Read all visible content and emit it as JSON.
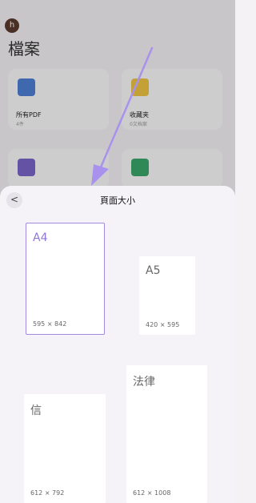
{
  "background": {
    "avatar_letter": "h",
    "title": "檔案",
    "cards": [
      {
        "name": "所有PDF",
        "sub": "4件",
        "icon": "file-icon",
        "color": "#4f7fd6"
      },
      {
        "name": "收藏夹",
        "sub": "0文档案",
        "icon": "star-folder-icon",
        "color": "#f0c542"
      },
      {
        "name": "",
        "sub": "",
        "icon": "folder-icon",
        "color": "#7a65c9"
      },
      {
        "name": "",
        "sub": "",
        "icon": "recycle-icon",
        "color": "#3aa86a"
      }
    ]
  },
  "sheet": {
    "title": "頁面大小",
    "back_glyph": "<",
    "sizes": [
      {
        "name": "A4",
        "dims": "595 × 842",
        "selected": true
      },
      {
        "name": "A5",
        "dims": "420 × 595",
        "selected": false
      },
      {
        "name": "信",
        "dims": "612 × 792",
        "selected": false
      },
      {
        "name": "法律",
        "dims": "612 × 1008",
        "selected": false
      }
    ]
  },
  "colors": {
    "accent": "#a48ae0",
    "arrow": "#a892ee"
  }
}
